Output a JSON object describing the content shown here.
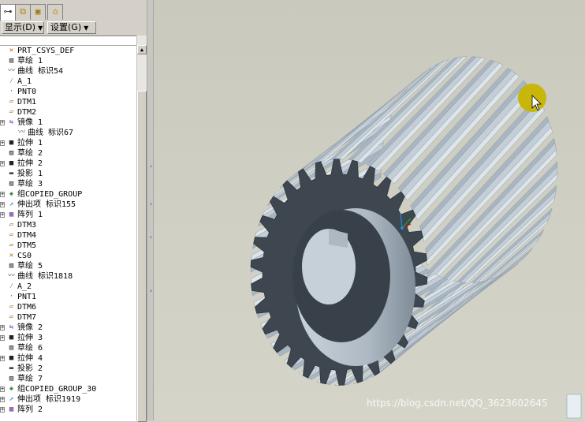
{
  "toolbar": {
    "display_label": "显示(D)",
    "settings_label": "设置(G)"
  },
  "tabs": [
    "model-tree-icon",
    "layer-icon",
    "folder-icon",
    "favorites-icon"
  ],
  "tree": {
    "items": [
      {
        "label": "PRT_CSYS_DEF",
        "icon": "csys-icon"
      },
      {
        "label": "草绘 1",
        "icon": "sketch-icon"
      },
      {
        "label": "曲线 标识54",
        "icon": "curve-icon"
      },
      {
        "label": "A_1",
        "icon": "axis-icon"
      },
      {
        "label": "PNT0",
        "icon": "point-icon"
      },
      {
        "label": "DTM1",
        "icon": "datum-plane-icon"
      },
      {
        "label": "DTM2",
        "icon": "datum-plane-icon"
      },
      {
        "label": "镜像 1",
        "icon": "mirror-icon"
      },
      {
        "label": "曲线 标识67",
        "icon": "curve-icon"
      },
      {
        "label": "拉伸 1",
        "icon": "extrude-icon"
      },
      {
        "label": "草绘 2",
        "icon": "sketch-icon"
      },
      {
        "label": "拉伸 2",
        "icon": "extrude-icon"
      },
      {
        "label": "投影 1",
        "icon": "projection-icon"
      },
      {
        "label": "草绘 3",
        "icon": "sketch-icon"
      },
      {
        "label": "组COPIED_GROUP",
        "icon": "group-icon"
      },
      {
        "label": "伸出项 标识155",
        "icon": "protrusion-icon"
      },
      {
        "label": "阵列 1",
        "icon": "pattern-icon"
      },
      {
        "label": "DTM3",
        "icon": "datum-plane-icon"
      },
      {
        "label": "DTM4",
        "icon": "datum-plane-icon"
      },
      {
        "label": "DTM5",
        "icon": "datum-plane-icon"
      },
      {
        "label": "CS0",
        "icon": "csys-icon"
      },
      {
        "label": "草绘 5",
        "icon": "sketch-icon"
      },
      {
        "label": "曲线 标识1818",
        "icon": "curve-icon"
      },
      {
        "label": "A_2",
        "icon": "axis-icon"
      },
      {
        "label": "PNT1",
        "icon": "point-icon"
      },
      {
        "label": "DTM6",
        "icon": "datum-plane-icon"
      },
      {
        "label": "DTM7",
        "icon": "datum-plane-icon"
      },
      {
        "label": "镜像 2",
        "icon": "mirror-icon"
      },
      {
        "label": "拉伸 3",
        "icon": "extrude-icon"
      },
      {
        "label": "草绘 6",
        "icon": "sketch-icon"
      },
      {
        "label": "拉伸 4",
        "icon": "extrude-icon"
      },
      {
        "label": "投影 2",
        "icon": "projection-icon"
      },
      {
        "label": "草绘 7",
        "icon": "sketch-icon"
      },
      {
        "label": "组COPIED_GROUP_30",
        "icon": "group-icon"
      },
      {
        "label": "伸出项 标识1919",
        "icon": "protrusion-icon"
      },
      {
        "label": "阵列 2",
        "icon": "pattern-icon"
      }
    ]
  },
  "graphics": {
    "model_name": "helical-gear-model",
    "gear_teeth": 30,
    "cursor_highlight_color": "#c8b400"
  },
  "watermark": "https://blog.csdn.net/QQ_3623602645",
  "colors": {
    "panel_bg": "#d4d0c8",
    "gear_face": "#3e4650",
    "gear_teeth": "#b9c5cf",
    "background": "#cbcbbf"
  }
}
